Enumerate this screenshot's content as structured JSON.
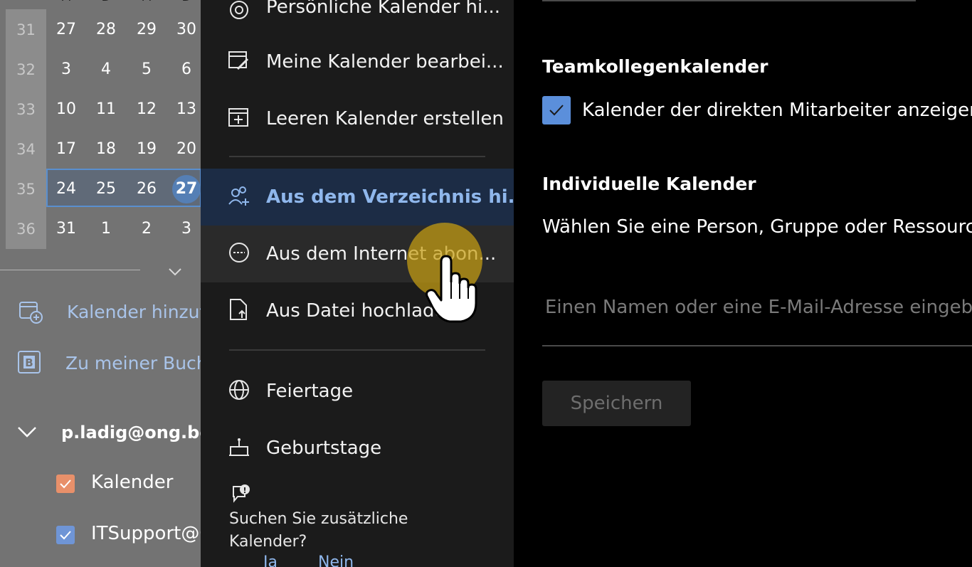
{
  "mini_calendar": {
    "weekday_headers": [
      "M",
      "D",
      "M",
      "D"
    ],
    "rows": [
      {
        "week": "31",
        "days": [
          "27",
          "28",
          "29",
          "30"
        ]
      },
      {
        "week": "32",
        "days": [
          "3",
          "4",
          "5",
          "6"
        ]
      },
      {
        "week": "33",
        "days": [
          "10",
          "11",
          "12",
          "13"
        ]
      },
      {
        "week": "34",
        "days": [
          "17",
          "18",
          "19",
          "20"
        ]
      },
      {
        "week": "35",
        "days": [
          "24",
          "25",
          "26",
          "27"
        ]
      },
      {
        "week": "36",
        "days": [
          "31",
          "1",
          "2",
          "3"
        ]
      }
    ],
    "today": "27"
  },
  "left_nav": {
    "add_calendar": "Kalender hinzuf",
    "bookings": "Zu meiner Buch",
    "account": "p.ladig@ong.be",
    "calendars": [
      {
        "label": "Kalender",
        "color": "#e8906a"
      },
      {
        "label": "ITSupport@O",
        "color": "#6f95d6"
      }
    ]
  },
  "menu": {
    "items": [
      {
        "label": "Persönliche Kalender hi...",
        "icon": "at-icon"
      },
      {
        "label": "Meine Kalender bearbei...",
        "icon": "edit-calendar-icon"
      },
      {
        "label": "Leeren Kalender erstellen",
        "icon": "add-calendar-icon"
      },
      {
        "label": "Aus dem Verzeichnis hi...",
        "icon": "people-add-icon"
      },
      {
        "label": "Aus dem Internet abon...",
        "icon": "www-icon"
      },
      {
        "label": "Aus Datei hochladen",
        "icon": "upload-file-icon"
      },
      {
        "label": "Feiertage",
        "icon": "globe-icon"
      },
      {
        "label": "Geburtstage",
        "icon": "cake-icon"
      }
    ],
    "feedback": {
      "question": "Suchen Sie zusätzliche Kalender?",
      "yes": "Ja",
      "no": "Nein"
    }
  },
  "content": {
    "team_heading": "Teamkollegenkalender",
    "team_checkbox_label": "Kalender der direkten Mitarbeiter anzeigen",
    "team_checkbox_checked": true,
    "individual_heading": "Individuelle Kalender",
    "individual_desc": "Wählen Sie eine Person, Gruppe oder Ressource a",
    "search_placeholder": "Einen Namen oder eine E-Mail-Adresse eingeben",
    "save_label": "Speichern"
  },
  "colors": {
    "accent": "#5b8fdb",
    "link": "#8fb7ec",
    "selected_bg": "#1c2c45",
    "cursor_highlight": "#c8a014"
  }
}
